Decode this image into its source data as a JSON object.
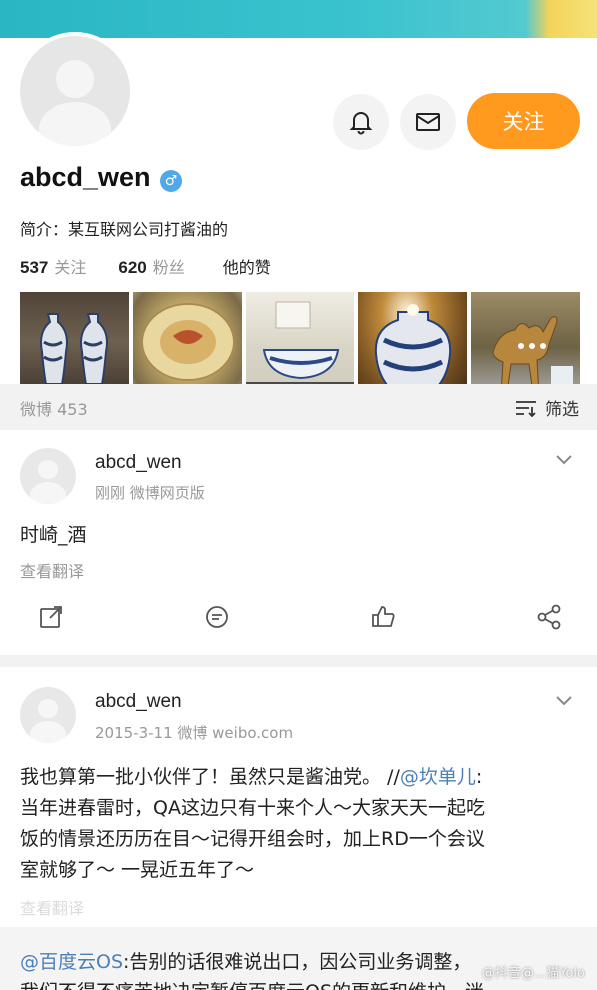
{
  "profile": {
    "username": "abcd_wen",
    "gender_symbol": "♂",
    "bio": "简介：某互联网公司打酱油的",
    "following_count": "537",
    "following_label": "关注",
    "followers_count": "620",
    "followers_label": "粉丝",
    "likes_label": "他的赞",
    "follow_button": "关注"
  },
  "feed_header": {
    "weibo_count": "微博 453",
    "filter_label": "筛选"
  },
  "posts": [
    {
      "author": "abcd_wen",
      "meta": "刚刚   微博网页版",
      "text": "时崎_酒",
      "translate": "查看翻译"
    },
    {
      "author": "abcd_wen",
      "meta": "2015-3-11   微博 weibo.com",
      "text_before_mention": "我也算第一批小伙伴了！虽然只是酱油党。 //",
      "mention": "@坎单儿",
      "text_after_mention": ":",
      "text_line2": "当年进春雷时，QA这边只有十来个人～大家天天一起吃",
      "text_line3": "饭的情景还历历在目～记得开组会时，加上RD一个会议",
      "text_line4": "室就够了～ 一晃近五年了～",
      "translate": "查看翻译"
    }
  ],
  "repost": {
    "mention": "@百度云OS",
    "text": ":告别的话很难说出口，因公司业务调整，",
    "line2": "我们不得不痛苦地决定暂停百度云OS的更新和维护。迷"
  },
  "watermark": "@抖音@...猫Yolo",
  "colors": {
    "accent_orange": "#ff9a1f",
    "link_blue": "#4c7fb8",
    "cover_teal": "#2bb6c4"
  }
}
